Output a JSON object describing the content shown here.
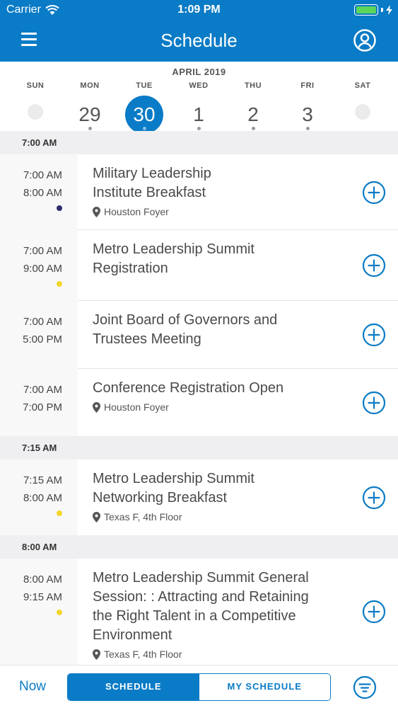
{
  "status_bar": {
    "carrier": "Carrier",
    "time": "1:09 PM"
  },
  "header": {
    "title": "Schedule"
  },
  "calendar": {
    "month_label": "APRIL 2019",
    "days": [
      {
        "name": "SUN",
        "number": "",
        "selected": false,
        "has_events": false
      },
      {
        "name": "MON",
        "number": "29",
        "selected": false,
        "has_events": true
      },
      {
        "name": "TUE",
        "number": "30",
        "selected": true,
        "has_events": true
      },
      {
        "name": "WED",
        "number": "1",
        "selected": false,
        "has_events": true
      },
      {
        "name": "THU",
        "number": "2",
        "selected": false,
        "has_events": true
      },
      {
        "name": "FRI",
        "number": "3",
        "selected": false,
        "has_events": true
      },
      {
        "name": "SAT",
        "number": "",
        "selected": false,
        "has_events": false
      }
    ]
  },
  "colors": {
    "accent": "#0a7bc6",
    "track_navy": "#2b2d6e",
    "track_yellow": "#f2d62a"
  },
  "sections": [
    {
      "label": "7:00 AM",
      "events": [
        {
          "start": "7:00 AM",
          "end": "8:00 AM",
          "title_lines": [
            "Military Leadership",
            "Institute Breakfast"
          ],
          "location": "Houston Foyer",
          "track_color": "#2b2d6e"
        },
        {
          "start": "7:00 AM",
          "end": "9:00 AM",
          "title_lines": [
            "Metro Leadership Summit",
            "Registration"
          ],
          "location": "",
          "track_color": "#f2d62a"
        },
        {
          "start": "7:00 AM",
          "end": "5:00 PM",
          "title_lines": [
            "Joint Board of Governors and",
            "Trustees Meeting"
          ],
          "location": "",
          "track_color": ""
        },
        {
          "start": "7:00 AM",
          "end": "7:00 PM",
          "title_lines": [
            "Conference Registration Open"
          ],
          "location": "Houston Foyer",
          "track_color": ""
        }
      ]
    },
    {
      "label": "7:15 AM",
      "events": [
        {
          "start": "7:15 AM",
          "end": "8:00 AM",
          "title_lines": [
            "Metro Leadership Summit",
            "Networking Breakfast"
          ],
          "location": "Texas F, 4th Floor",
          "track_color": "#f2d62a"
        }
      ]
    },
    {
      "label": "8:00 AM",
      "events": [
        {
          "start": "8:00 AM",
          "end": "9:15 AM",
          "title_lines": [
            "Metro Leadership Summit General",
            "Session: : Attracting and Retaining",
            "the Right Talent in a Competitive",
            "Environment"
          ],
          "location": "Texas F, 4th Floor",
          "track_color": "#f2d62a"
        }
      ]
    }
  ],
  "bottom_bar": {
    "now_label": "Now",
    "schedule_tab": "SCHEDULE",
    "my_schedule_tab": "MY SCHEDULE"
  }
}
